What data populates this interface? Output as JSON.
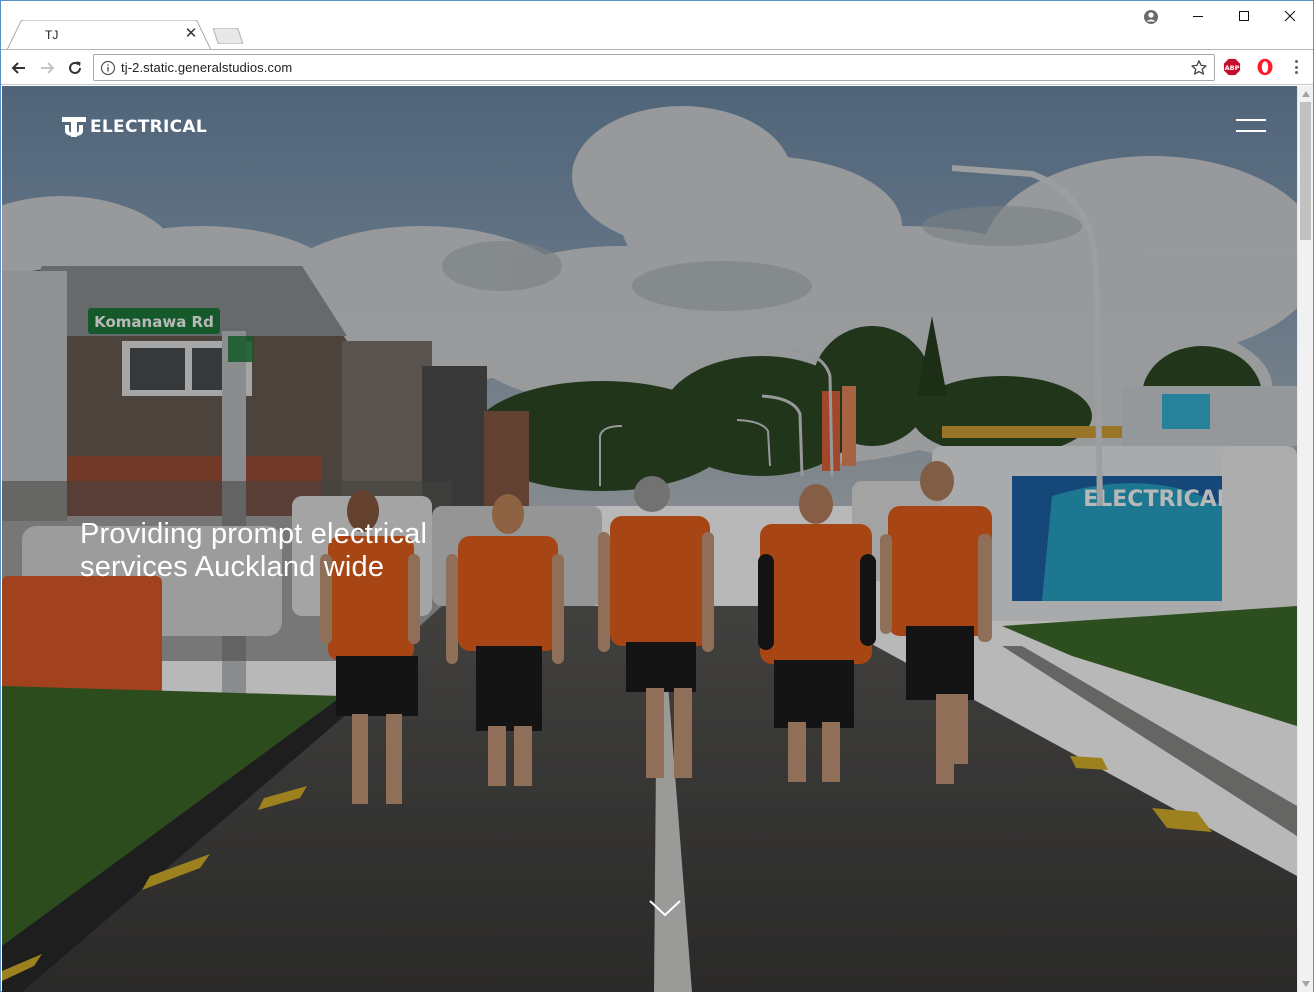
{
  "browser": {
    "tab_title": "TJ",
    "url": "tj-2.static.generalstudios.com",
    "extensions": [
      "adblock-plus",
      "opera"
    ]
  },
  "site": {
    "logo_text": "ELECTRICAL",
    "hero_heading": "Providing prompt electrical services Auckland wide",
    "street_sign": "Komanawa Rd",
    "van_lettering": "ELECTRICAL"
  },
  "colors": {
    "brand_orange": "#ff6a1a",
    "hero_overlay": "#000000"
  },
  "icons": {
    "back": "arrow-left-icon",
    "forward": "arrow-right-icon",
    "reload": "reload-icon",
    "info": "info-icon",
    "star": "star-icon",
    "menu": "hamburger-icon",
    "scroll": "chevron-down-icon"
  }
}
